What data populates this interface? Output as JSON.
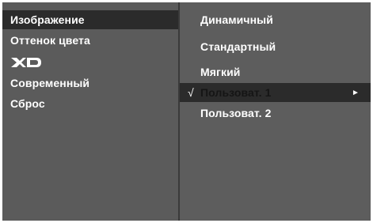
{
  "left_menu": {
    "items": [
      {
        "label": "Изображение",
        "selected": true
      },
      {
        "label": "Оттенок цвета",
        "selected": false
      },
      {
        "label": "XD",
        "selected": false,
        "logo": true
      },
      {
        "label": "Современный",
        "selected": false
      },
      {
        "label": "Сброс",
        "selected": false
      }
    ]
  },
  "right_menu": {
    "items": [
      {
        "label": "Динамичный",
        "selected": false
      },
      {
        "label": "Стандартный",
        "selected": false
      },
      {
        "label": "Мягкий",
        "selected": false
      },
      {
        "label": "Пользоват. 1",
        "selected": true,
        "checkmark": "√",
        "arrow": "►"
      },
      {
        "label": "Пользоват. 2",
        "selected": false
      }
    ]
  },
  "colors": {
    "panel": "#5b5b5b",
    "highlight": "#2b2b2b",
    "text": "#ffffff"
  }
}
